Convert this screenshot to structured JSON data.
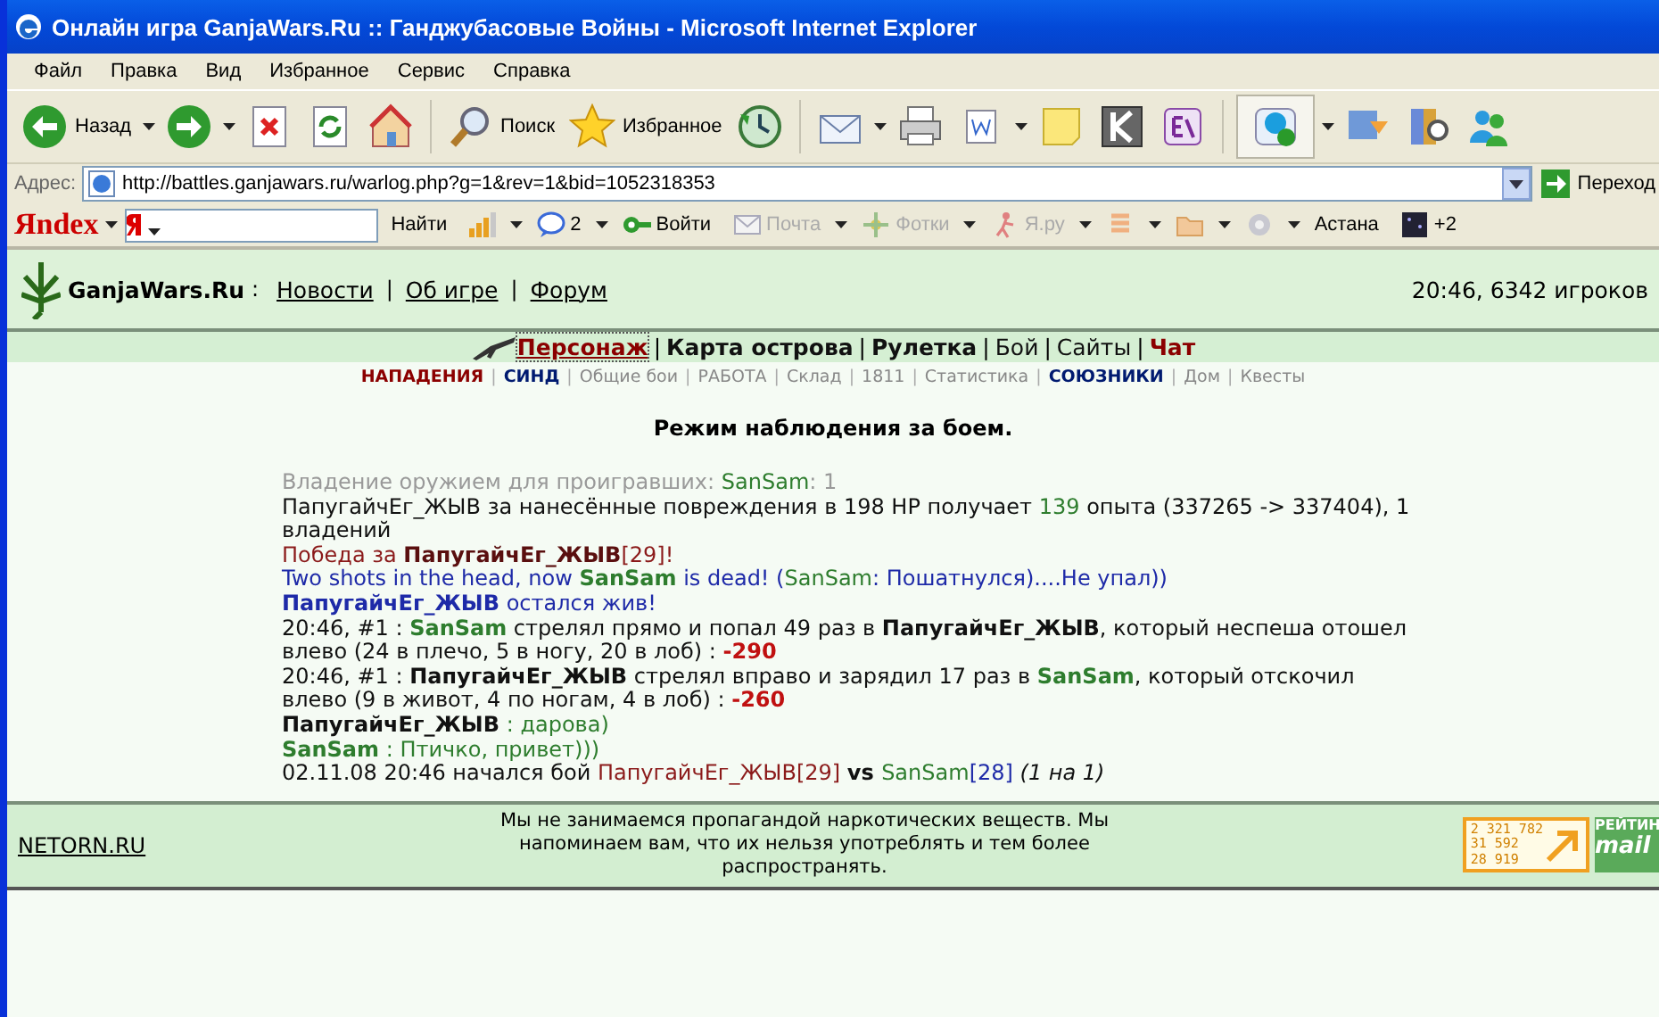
{
  "window": {
    "title": "Онлайн игра GanjaWars.Ru :: Ганджубасовые Войны - Microsoft Internet Explorer"
  },
  "menu": [
    "Файл",
    "Правка",
    "Вид",
    "Избранное",
    "Сервис",
    "Справка"
  ],
  "toolbar": [
    {
      "kind": "back",
      "label": "Назад",
      "dropdown": true
    },
    {
      "kind": "forward",
      "dropdown": true
    },
    {
      "kind": "stop",
      "dropdown": false
    },
    {
      "kind": "refresh",
      "dropdown": false
    },
    {
      "kind": "home",
      "dropdown": false
    },
    {
      "kind": "search",
      "label": "Поиск",
      "dropdown": false
    },
    {
      "kind": "star",
      "label": "Избранное",
      "dropdown": false
    },
    {
      "kind": "history",
      "dropdown": false
    },
    {
      "kind": "mail",
      "dropdown": true
    },
    {
      "kind": "print",
      "dropdown": false
    },
    {
      "kind": "doc",
      "dropdown": true
    },
    {
      "kind": "note",
      "dropdown": false
    },
    {
      "kind": "kbox",
      "dropdown": false
    },
    {
      "kind": "dict",
      "dropdown": false
    },
    {
      "kind": "skype",
      "dropdown": true
    },
    {
      "kind": "download",
      "dropdown": false
    },
    {
      "kind": "research",
      "dropdown": false
    },
    {
      "kind": "messenger",
      "dropdown": false
    }
  ],
  "address": {
    "label": "Адрес:",
    "value": "http://battles.ganjawars.ru/warlog.php?g=1&rev=1&bid=1052318353",
    "go": "Переход"
  },
  "yandex_bar": {
    "logo": "Яndex",
    "search_button": "Найти",
    "items": [
      {
        "kind": "signal",
        "dropdown": true,
        "disabled": false
      },
      {
        "kind": "chat",
        "label": "2",
        "dropdown": true,
        "disabled": false
      },
      {
        "kind": "login",
        "label": "Войти",
        "disabled": false,
        "dropdown": false
      },
      {
        "kind": "mail",
        "label": "Почта",
        "disabled": true,
        "dropdown": true
      },
      {
        "kind": "photo",
        "label": "Фотки",
        "disabled": true,
        "dropdown": true
      },
      {
        "kind": "person",
        "label": "Я.ру",
        "disabled": true,
        "dropdown": true
      },
      {
        "kind": "money",
        "disabled": true,
        "dropdown": true
      },
      {
        "kind": "folder",
        "disabled": true,
        "dropdown": true
      },
      {
        "kind": "gear",
        "disabled": true,
        "dropdown": true
      },
      {
        "kind": "city",
        "label": "Астана",
        "disabled": false,
        "dropdown": false
      },
      {
        "kind": "weather",
        "label": "+2",
        "disabled": false,
        "dropdown": false
      }
    ]
  },
  "site": {
    "name": "GanjaWars.Ru",
    "separator": ":",
    "links": [
      {
        "label": "Новости"
      },
      {
        "divider": "|",
        "label": "Об игре"
      },
      {
        "divider": "|",
        "label": "Форум"
      }
    ],
    "status": "20:46, 6342 игроков"
  },
  "nav": [
    {
      "label": "Персонаж",
      "kind": "accent",
      "selected": true
    },
    {
      "divider": "|",
      "label": "Карта острова",
      "kind": "bold",
      "selected": false
    },
    {
      "divider": "|",
      "label": "Рулетка",
      "kind": "bold",
      "selected": false
    },
    {
      "divider": "|",
      "label": "Бой",
      "kind": "normal",
      "selected": false
    },
    {
      "divider": "|",
      "label": "Сайты",
      "kind": "normal",
      "selected": false
    },
    {
      "divider": "|",
      "label": "Чат",
      "kind": "accent",
      "selected": false
    }
  ],
  "subnav": [
    {
      "label": "НАПАДЕНИЯ",
      "kind": "red"
    },
    {
      "divider": "|",
      "label": "СИНД",
      "kind": "blue"
    },
    {
      "divider": "|",
      "label": "Общие бои",
      "kind": "grey"
    },
    {
      "divider": "|",
      "label": "РАБОТА",
      "kind": "grey"
    },
    {
      "divider": "|",
      "label": "Склад",
      "kind": "grey"
    },
    {
      "divider": "|",
      "label": "1811",
      "kind": "grey"
    },
    {
      "divider": "|",
      "label": "Статистика",
      "kind": "grey"
    },
    {
      "divider": "|",
      "label": "СОЮЗНИКИ",
      "kind": "blue"
    },
    {
      "divider": "|",
      "label": "Дом",
      "kind": "grey"
    },
    {
      "divider": "|",
      "label": "Квесты",
      "kind": "grey"
    }
  ],
  "heading": "Режим наблюдения за боем.",
  "log": [
    [
      {
        "kind": "grey",
        "text": "Владение оружием для проигравших: "
      },
      {
        "kind": "green",
        "text": "SanSam"
      },
      {
        "kind": "grey",
        "text": ": 1"
      }
    ],
    [
      {
        "kind": "plain",
        "text": "ПапугайчЕг_ЖЫВ за нанесённые повреждения в 198 HP получает "
      },
      {
        "kind": "green",
        "text": "139"
      },
      {
        "kind": "plain",
        "text": " опыта (337265 -> 337404), 1 владений"
      }
    ],
    [
      {
        "kind": "maroon",
        "text": "Победа за "
      },
      {
        "kind": "maroon-bold",
        "text": "ПапугайчЕг_ЖЫВ"
      },
      {
        "kind": "maroon",
        "text": "[29]!"
      }
    ],
    [
      {
        "kind": "blue",
        "text": "Two shots in the head, now "
      },
      {
        "kind": "green-bold",
        "text": "SanSam"
      },
      {
        "kind": "blue",
        "text": " is dead! ("
      },
      {
        "kind": "green",
        "text": "SanSam"
      },
      {
        "kind": "blue",
        "text": ": Пошатнулся)....Не упал))"
      }
    ],
    [
      {
        "kind": "blue-bold",
        "text": "ПапугайчЕг_ЖЫВ"
      },
      {
        "kind": "blue",
        "text": " остался жив!"
      }
    ],
    [
      {
        "kind": "plain",
        "text": "20:46, #1 : "
      },
      {
        "kind": "green-bold",
        "text": "SanSam"
      },
      {
        "kind": "plain",
        "text": " стрелял прямо и попал 49 раз в "
      },
      {
        "kind": "bold",
        "text": "ПапугайчЕг_ЖЫВ"
      },
      {
        "kind": "plain",
        "text": ", который неспеша отошел влево (24 в плечо, 5 в ногу, 20 в лоб) : "
      },
      {
        "kind": "red-bold",
        "text": "-290"
      }
    ],
    [
      {
        "kind": "plain",
        "text": "20:46, #1 : "
      },
      {
        "kind": "bold",
        "text": "ПапугайчЕг_ЖЫВ"
      },
      {
        "kind": "plain",
        "text": " стрелял вправо и зарядил 17 раз в "
      },
      {
        "kind": "green-bold",
        "text": "SanSam"
      },
      {
        "kind": "plain",
        "text": ", который отскочил влево (9 в живот, 4 по ногам, 4 в лоб) : "
      },
      {
        "kind": "red-bold",
        "text": "-260"
      }
    ],
    [
      {
        "kind": "bold",
        "text": "ПапугайчЕг_ЖЫВ"
      },
      {
        "kind": "green",
        "text": " : дарова)"
      }
    ],
    [
      {
        "kind": "green-bold",
        "text": "SanSam"
      },
      {
        "kind": "green",
        "text": " : Птичко, привет)))"
      }
    ],
    [
      {
        "kind": "plain",
        "text": "02.11.08 20:46 начался бой "
      },
      {
        "kind": "maroon",
        "text": "ПапугайчЕг_ЖЫВ[29] "
      },
      {
        "kind": "bold",
        "text": "vs "
      },
      {
        "kind": "green",
        "text": "SanSam"
      },
      {
        "kind": "blue",
        "text": "[28] "
      },
      {
        "kind": "italic",
        "text": "(1 на 1)"
      }
    ]
  ],
  "footer": {
    "link": "NETORN.RU",
    "notice": "Мы не занимаемся пропагандой наркотических веществ. Мы напоминаем вам, что их нельзя употреблять и тем более распространять.",
    "counter": [
      "2 321 782",
      "31 592",
      "28 919"
    ],
    "rating": [
      "РЕЙТИН",
      "mail"
    ]
  }
}
